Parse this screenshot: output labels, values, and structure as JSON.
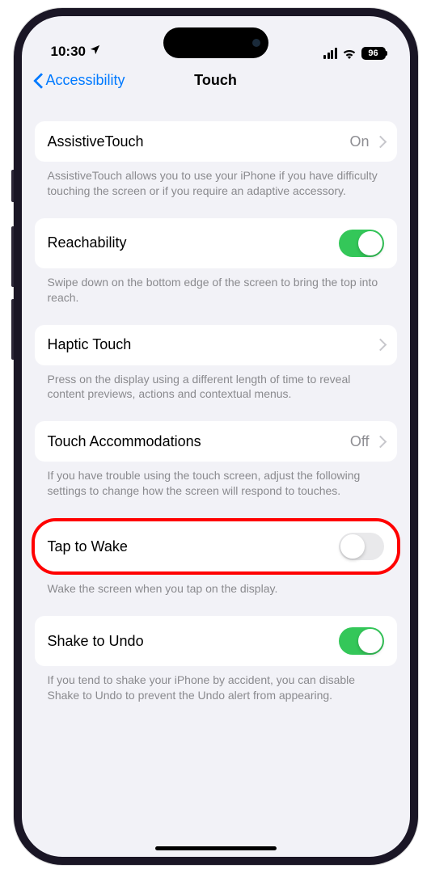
{
  "status": {
    "time": "10:30",
    "battery": "96"
  },
  "nav": {
    "back_label": "Accessibility",
    "title": "Touch"
  },
  "rows": {
    "assistive": {
      "label": "AssistiveTouch",
      "value": "On",
      "footer": "AssistiveTouch allows you to use your iPhone if you have difficulty touching the screen or if you require an adaptive accessory."
    },
    "reachability": {
      "label": "Reachability",
      "footer": "Swipe down on the bottom edge of the screen to bring the top into reach."
    },
    "haptic": {
      "label": "Haptic Touch",
      "footer": "Press on the display using a different length of time to reveal content previews, actions and contextual menus."
    },
    "accommodations": {
      "label": "Touch Accommodations",
      "value": "Off",
      "footer": "If you have trouble using the touch screen, adjust the following settings to change how the screen will respond to touches."
    },
    "tapwake": {
      "label": "Tap to Wake",
      "footer": "Wake the screen when you tap on the display."
    },
    "shake": {
      "label": "Shake to Undo",
      "footer": "If you tend to shake your iPhone by accident, you can disable Shake to Undo to prevent the Undo alert from appearing."
    }
  }
}
